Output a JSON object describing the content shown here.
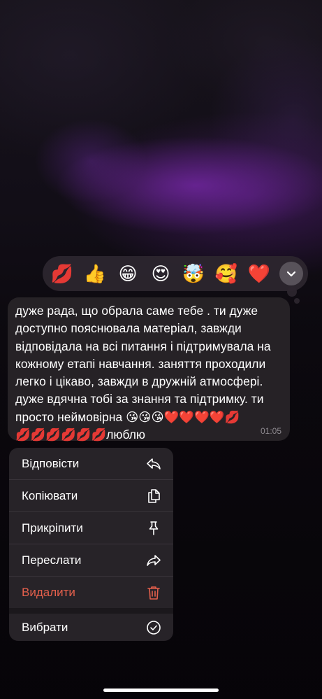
{
  "reactions": [
    {
      "emoji": "💋",
      "name": "kiss-mark"
    },
    {
      "emoji": "👍",
      "name": "thumbs-up"
    },
    {
      "emoji": "😁",
      "name": "beaming-face"
    },
    {
      "emoji": "😍",
      "name": "heart-eyes"
    },
    {
      "emoji": "🤯",
      "name": "exploding-head"
    },
    {
      "emoji": "🥰",
      "name": "smiling-face-with-hearts"
    },
    {
      "emoji": "❤️",
      "name": "red-heart"
    }
  ],
  "message": {
    "lines": [
      "дуже рада, що обрала саме тебе . ти дуже",
      "доступно пояснювала матеріал, завжди",
      "відповідала на всі питання і підтримувала на",
      "кожному етапі навчання. заняття проходили",
      "легко і цікаво, завжди в дружній атмосфері.",
      "дуже вдячна тобі за знання та підтримку. ти",
      "просто неймовірна 😘😘😘❤️❤️❤️❤️💋",
      "💋💋💋💋💋💋люблю"
    ],
    "time": "01:05"
  },
  "menu": {
    "reply": "Відповісти",
    "copy": "Копіювати",
    "pin": "Прикріпити",
    "forward": "Переслати",
    "delete": "Видалити",
    "select": "Вибрати"
  },
  "colors": {
    "danger": "#e5604c",
    "bubble": "#262226",
    "menu_bg": "#282429"
  }
}
